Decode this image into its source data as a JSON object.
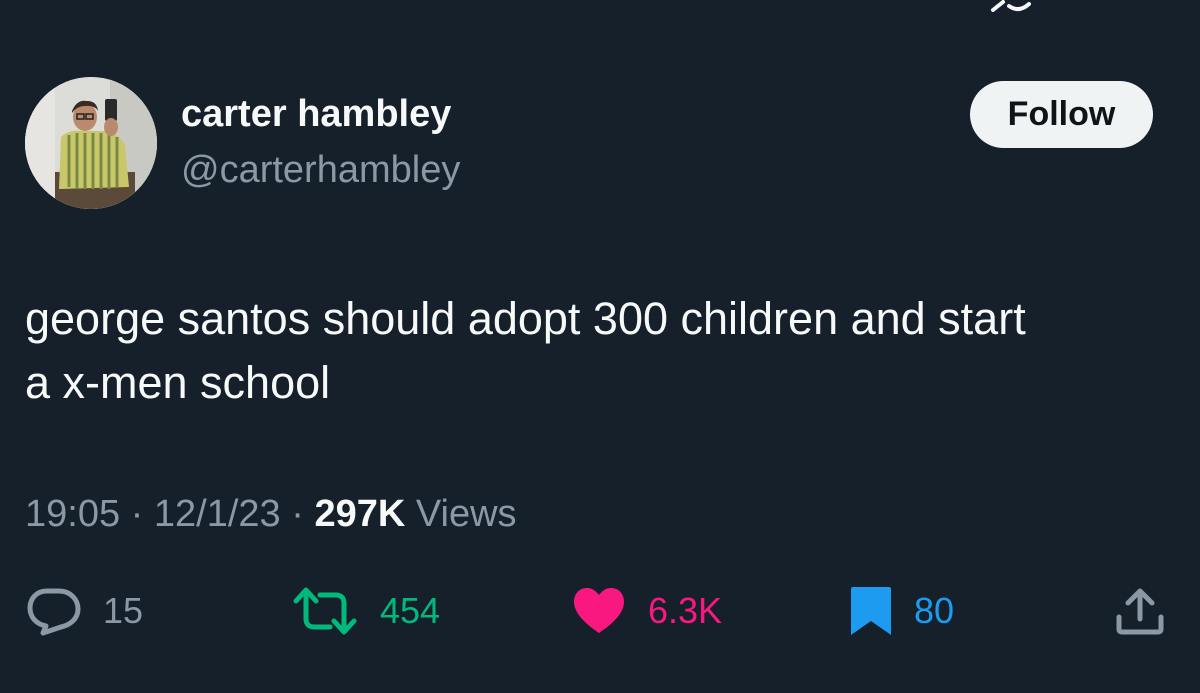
{
  "tweet": {
    "author_name": "carter hambley",
    "author_handle": "@carterhambley",
    "follow_label": "Follow",
    "text_line1": "george santos should adopt 300 children and start",
    "text_line2": "a x-men school",
    "time": "19:05",
    "sep1": "·",
    "date": "12/1/23",
    "sep2": "·",
    "views_count": "297K",
    "views_label": "Views"
  },
  "actions": {
    "replies": "15",
    "retweets": "454",
    "likes": "6.3K",
    "bookmarks": "80"
  },
  "icons": {
    "reply": "reply-icon",
    "retweet": "retweet-icon",
    "like": "heart-icon",
    "bookmark": "bookmark-icon",
    "share": "share-icon"
  },
  "colors": {
    "background": "#15202b",
    "primary_text": "#f7f9f9",
    "secondary_text": "#8b98a5",
    "retweet": "#00ba7c",
    "like": "#f91880",
    "bookmark": "#1d9bf0",
    "follow_button_bg": "#eff3f4"
  }
}
